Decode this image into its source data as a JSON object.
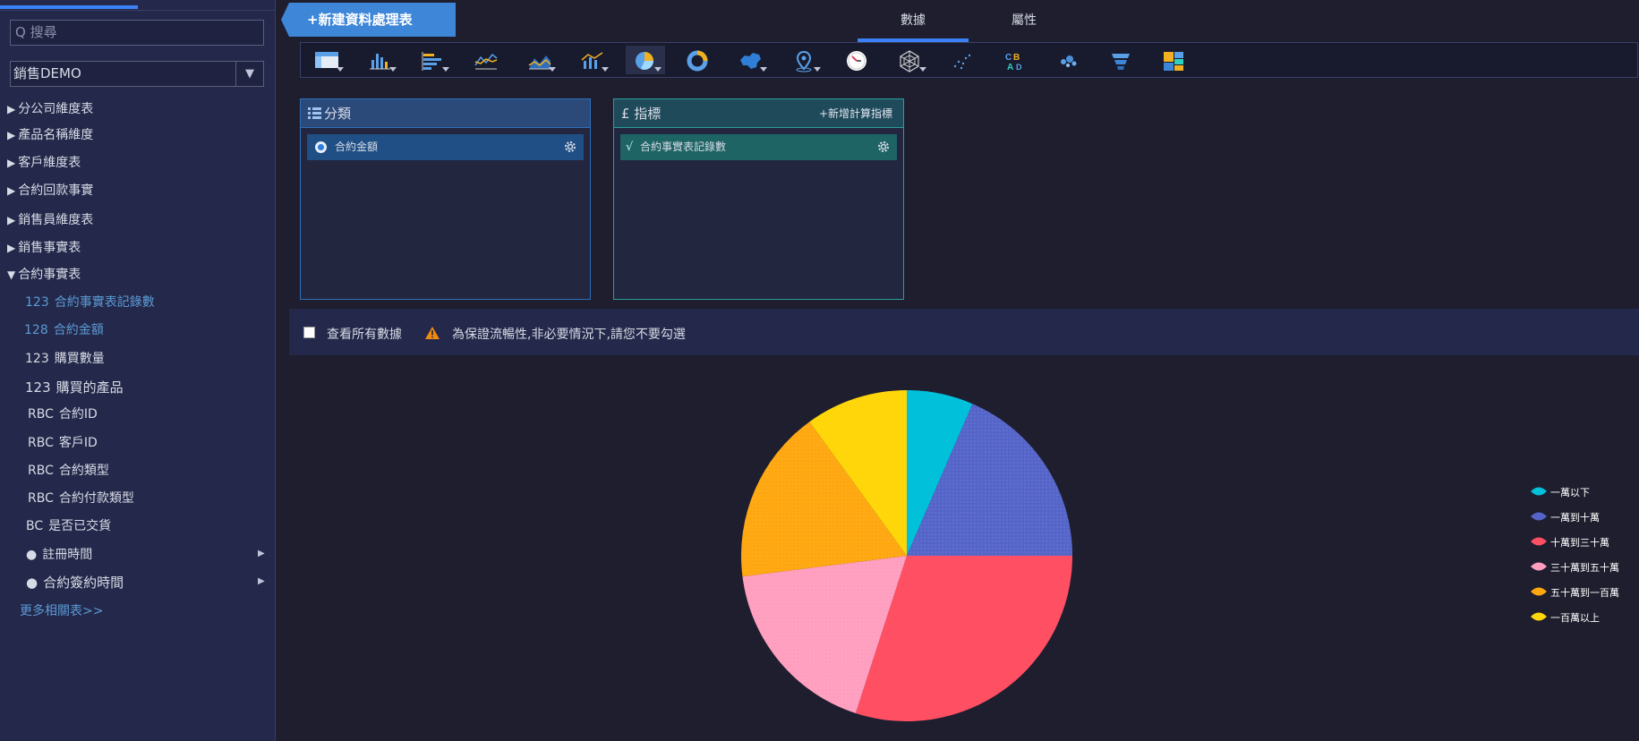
{
  "sidebar": {
    "search_placeholder": "Q 搜尋",
    "datasource": "銷售DEMO",
    "datasource_arrow": "▼",
    "tables": [
      {
        "label": "分公司維度表",
        "expanded": false
      },
      {
        "label": "產品名稱維度",
        "expanded": false
      },
      {
        "label": "客戶維度表",
        "expanded": false
      },
      {
        "label": "合約回款事實",
        "expanded": false
      },
      {
        "label": "銷售員維度表",
        "expanded": false
      },
      {
        "label": "銷售事實表",
        "expanded": false
      },
      {
        "label": "合約事實表",
        "expanded": true
      }
    ],
    "tri_collapsed": "▶",
    "tri_expanded": "▼",
    "fields": [
      {
        "prefix": "123",
        "label": "合約事實表記錄數",
        "active": true
      },
      {
        "prefix": "128",
        "label": "合約金額",
        "active": true
      },
      {
        "prefix": "123",
        "label": "購買數量",
        "active": false
      },
      {
        "prefix": "123",
        "label": "購買的產品",
        "active": false
      },
      {
        "prefix": "RBC",
        "label": "合約ID",
        "active": false
      },
      {
        "prefix": "RBC",
        "label": "客戶ID",
        "active": false
      },
      {
        "prefix": "RBC",
        "label": "合約類型",
        "active": false
      },
      {
        "prefix": "RBC",
        "label": "合約付款類型",
        "active": false
      },
      {
        "prefix": "BC",
        "label": "是否已交貨",
        "active": false
      },
      {
        "prefix": "●",
        "label": "註冊時間",
        "active": false,
        "has_sub": true
      },
      {
        "prefix": "●",
        "label": "合約簽約時間",
        "active": false,
        "has_sub": true
      }
    ],
    "sub_arrow": "▶",
    "more_link": "更多相關表>>"
  },
  "header": {
    "new_button": "+新建資料處理表",
    "tabs": [
      {
        "label": "數據",
        "active": true
      },
      {
        "label": "屬性",
        "active": false
      }
    ]
  },
  "toolbar": {
    "chart_types": [
      {
        "icon": "table-icon",
        "dropdown": true,
        "selected": false
      },
      {
        "icon": "bar-chart-icon",
        "dropdown": true,
        "selected": false
      },
      {
        "icon": "horizontal-bar-icon",
        "dropdown": true,
        "selected": false
      },
      {
        "icon": "line-chart-icon",
        "dropdown": false,
        "selected": false
      },
      {
        "icon": "area-chart-icon",
        "dropdown": true,
        "selected": false
      },
      {
        "icon": "combo-chart-icon",
        "dropdown": true,
        "selected": false
      },
      {
        "icon": "pie-chart-icon",
        "dropdown": true,
        "selected": true
      },
      {
        "icon": "donut-chart-icon",
        "dropdown": false,
        "selected": false
      },
      {
        "icon": "china-map-icon",
        "dropdown": true,
        "selected": false
      },
      {
        "icon": "map-pin-icon",
        "dropdown": true,
        "selected": false
      },
      {
        "icon": "gauge-icon",
        "dropdown": false,
        "selected": false
      },
      {
        "icon": "radar-chart-icon",
        "dropdown": true,
        "selected": false
      },
      {
        "icon": "scatter-icon",
        "dropdown": false,
        "selected": false
      },
      {
        "icon": "word-cloud-icon",
        "dropdown": false,
        "selected": false
      },
      {
        "icon": "bubble-icon",
        "dropdown": false,
        "selected": false
      },
      {
        "icon": "funnel-icon",
        "dropdown": false,
        "selected": false
      },
      {
        "icon": "treemap-icon",
        "dropdown": false,
        "selected": false
      }
    ]
  },
  "panels": {
    "category": {
      "title": "分類",
      "item": "合約金額"
    },
    "metric": {
      "title": "£ 指標",
      "action": "+新增計算指標",
      "item": "合約事實表記錄數"
    }
  },
  "options": {
    "view_all_label": "查看所有數據",
    "view_all_checked": false,
    "warning": "為保證流暢性,非必要情況下,請您不要勾選"
  },
  "chart_data": {
    "type": "pie",
    "categories": [
      "一萬以下",
      "一萬到十萬",
      "十萬到三十萬",
      "三十萬到五十萬",
      "五十萬到一百萬",
      "一百萬以上"
    ],
    "values": [
      6.5,
      18.5,
      30,
      18,
      17,
      10
    ],
    "colors": [
      "#00c0da",
      "#5564c8",
      "#ff4f63",
      "#ff9ebf",
      "#ffa70f",
      "#ffd60a"
    ],
    "legend_position": "right"
  }
}
